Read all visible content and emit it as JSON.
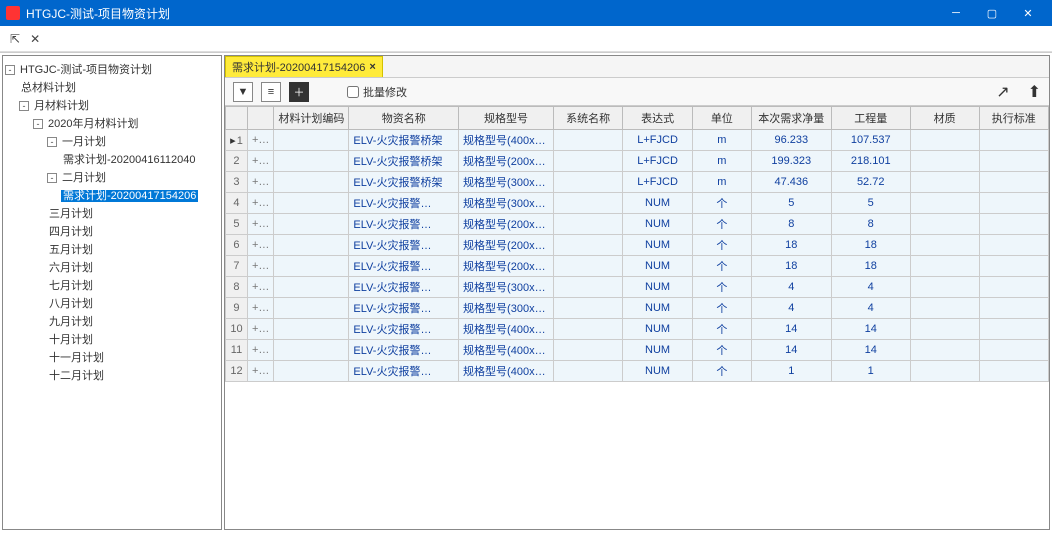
{
  "window": {
    "title": "HTGJC-测试-项目物资计划"
  },
  "tree": {
    "root": "HTGJC-测试-项目物资计划",
    "n_total": "总材料计划",
    "n_month": "月材料计划",
    "n_2020": "2020年月材料计划",
    "m1": "一月计划",
    "m1_req": "需求计划-20200416112040",
    "m2": "二月计划",
    "m2_req": "需求计划-20200417154206",
    "m3": "三月计划",
    "m4": "四月计划",
    "m5": "五月计划",
    "m6": "六月计划",
    "m7": "七月计划",
    "m8": "八月计划",
    "m9": "九月计划",
    "m10": "十月计划",
    "m11": "十一月计划",
    "m12": "十二月计划"
  },
  "tab": {
    "label": "需求计划-20200417154206"
  },
  "toolbar": {
    "batch_edit": "批量修改"
  },
  "columns": {
    "code": "材料计划编码",
    "name": "物资名称",
    "spec": "规格型号",
    "sys": "系统名称",
    "expr": "表达式",
    "unit": "单位",
    "qty": "本次需求净量",
    "eng": "工程量",
    "mat": "材质",
    "std": "执行标准"
  },
  "rows": [
    {
      "name": "ELV-火灾报警桥架",
      "spec": "规格型号(400x…",
      "expr": "L+FJCD",
      "unit": "m",
      "qty": "96.233",
      "eng": "107.537"
    },
    {
      "name": "ELV-火灾报警桥架",
      "spec": "规格型号(200x…",
      "expr": "L+FJCD",
      "unit": "m",
      "qty": "199.323",
      "eng": "218.101"
    },
    {
      "name": "ELV-火灾报警桥架",
      "spec": "规格型号(300x…",
      "expr": "L+FJCD",
      "unit": "m",
      "qty": "47.436",
      "eng": "52.72"
    },
    {
      "name": "ELV-火灾报警…",
      "spec": "规格型号(300x…",
      "expr": "NUM",
      "unit": "个",
      "qty": "5",
      "eng": "5"
    },
    {
      "name": "ELV-火灾报警…",
      "spec": "规格型号(200x…",
      "expr": "NUM",
      "unit": "个",
      "qty": "8",
      "eng": "8"
    },
    {
      "name": "ELV-火灾报警…",
      "spec": "规格型号(200x…",
      "expr": "NUM",
      "unit": "个",
      "qty": "18",
      "eng": "18"
    },
    {
      "name": "ELV-火灾报警…",
      "spec": "规格型号(200x…",
      "expr": "NUM",
      "unit": "个",
      "qty": "18",
      "eng": "18"
    },
    {
      "name": "ELV-火灾报警…",
      "spec": "规格型号(300x…",
      "expr": "NUM",
      "unit": "个",
      "qty": "4",
      "eng": "4"
    },
    {
      "name": "ELV-火灾报警…",
      "spec": "规格型号(300x…",
      "expr": "NUM",
      "unit": "个",
      "qty": "4",
      "eng": "4"
    },
    {
      "name": "ELV-火灾报警…",
      "spec": "规格型号(400x…",
      "expr": "NUM",
      "unit": "个",
      "qty": "14",
      "eng": "14"
    },
    {
      "name": "ELV-火灾报警…",
      "spec": "规格型号(400x…",
      "expr": "NUM",
      "unit": "个",
      "qty": "14",
      "eng": "14"
    },
    {
      "name": "ELV-火灾报警…",
      "spec": "规格型号(400x…",
      "expr": "NUM",
      "unit": "个",
      "qty": "1",
      "eng": "1"
    }
  ]
}
